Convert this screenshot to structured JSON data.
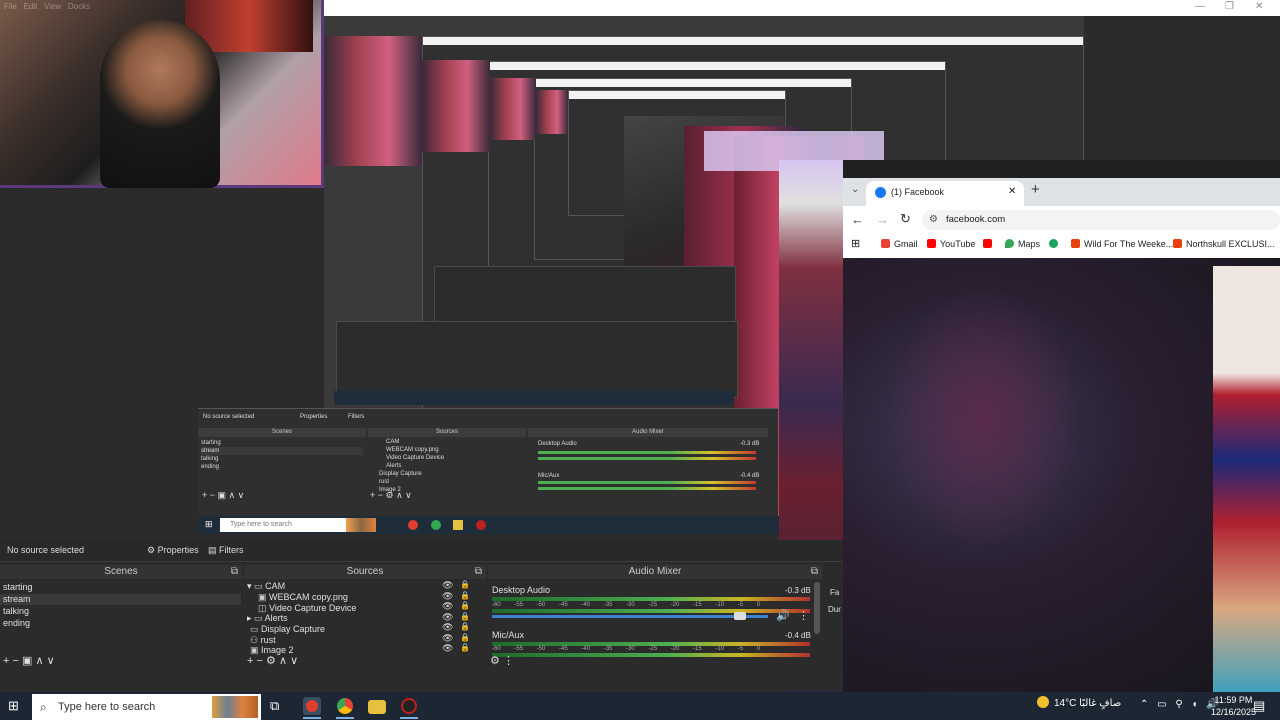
{
  "webcam_overlay": {
    "menu_items": [
      "File",
      "Edit",
      "View",
      "Docks"
    ]
  },
  "obs_mid": {
    "no_source": "No source selected",
    "properties": "Properties",
    "filters": "Filters",
    "scenes_head": "Scenes",
    "sources_head": "Sources",
    "mixer_head": "Audio Mixer",
    "scenes": [
      "starting",
      "stream",
      "talking",
      "ending"
    ],
    "sources": [
      "CAM",
      "WEBCAM copy.png",
      "Video Capture Device",
      "Alerts",
      "Display Capture",
      "rust",
      "Image 2"
    ],
    "desktop_audio": "Desktop Audio",
    "desktop_db": "-0.3 dB",
    "mic": "Mic/Aux",
    "mic_db": "-0.4 dB",
    "search_placeholder": "Type here to search"
  },
  "browser": {
    "tab_title": "(1) Facebook",
    "url": "facebook.com",
    "bookmarks": [
      {
        "label": "Gmail",
        "color": "#ea4335"
      },
      {
        "label": "YouTube",
        "color": "#ff0000"
      },
      {
        "label": "",
        "color": "#ff0000"
      },
      {
        "label": "Maps",
        "color": "#34a853"
      },
      {
        "label": "",
        "color": "#1aa260"
      },
      {
        "label": "Wild For The Weeke...",
        "color": "#e8400c"
      },
      {
        "label": "Northskull EXCLUSI...",
        "color": "#e8400c"
      }
    ]
  },
  "obs": {
    "no_source": "No source selected",
    "properties": "Properties",
    "filters": "Filters",
    "scenes_head": "Scenes",
    "sources_head": "Sources",
    "mixer_head": "Audio Mixer",
    "scenes": [
      "starting",
      "stream",
      "talking",
      "ending"
    ],
    "sources": [
      {
        "name": "CAM",
        "expand": "▾"
      },
      {
        "name": "WEBCAM copy.png",
        "expand": ""
      },
      {
        "name": "Video Capture Device",
        "expand": ""
      },
      {
        "name": "Alerts",
        "expand": "▸"
      },
      {
        "name": "Display Capture",
        "expand": ""
      },
      {
        "name": "rust",
        "expand": ""
      },
      {
        "name": "Image 2",
        "expand": ""
      }
    ],
    "desktop_audio": "Desktop Audio",
    "desktop_db": "-0.3 dB",
    "mic": "Mic/Aux",
    "mic_db": "-0.4 dB",
    "scale": "-60 -55 -50 -45 -40 -35 -30 -25 -20 -15 -10 -5 0",
    "desktop_volume": 0.9,
    "right_labels": [
      "Fa",
      "Dur"
    ]
  },
  "taskbar": {
    "search_placeholder": "Type here to search",
    "weather": "14°C  صافٍ غالبًا",
    "time": "11:59 PM",
    "date": "12/16/2025"
  }
}
